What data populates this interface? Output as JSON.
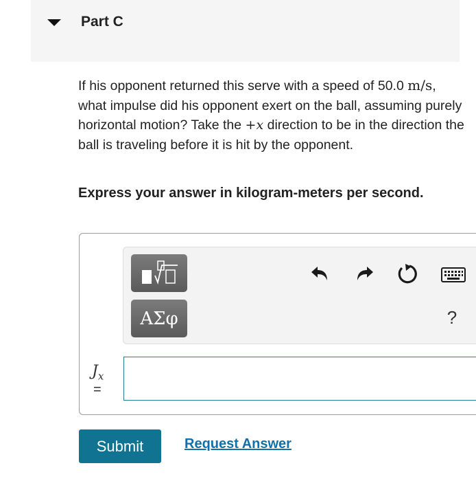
{
  "part": {
    "title": "Part C"
  },
  "question": {
    "line_1": "If his opponent returned this serve with a speed of",
    "speed_value": "50.0",
    "speed_unit": "m/s",
    "line_2_rest": ", what impulse did his opponent exert on the ball, assuming purely horizontal motion? Take the",
    "direction_symbol": "+x",
    "line_3": "direction to be in the direction the ball is traveling before it is hit by the opponent."
  },
  "instruction": "Express your answer in kilogram-meters per second.",
  "toolbar": {
    "templates_icon": "templates-icon",
    "symbols_label": "ΑΣφ",
    "undo_icon": "undo-icon",
    "redo_icon": "redo-icon",
    "reset_icon": "reset-icon",
    "keyboard_icon": "keyboard-icon",
    "help_label": "?"
  },
  "answer": {
    "variable": "J",
    "subscript": "x",
    "equals": "=",
    "value": ""
  },
  "actions": {
    "submit_label": "Submit",
    "request_label": "Request Answer"
  },
  "colors": {
    "submit_bg": "#0f7391",
    "link": "#1170a8",
    "input_border": "#2b7d8f",
    "header_bg": "#f5f5f5"
  }
}
